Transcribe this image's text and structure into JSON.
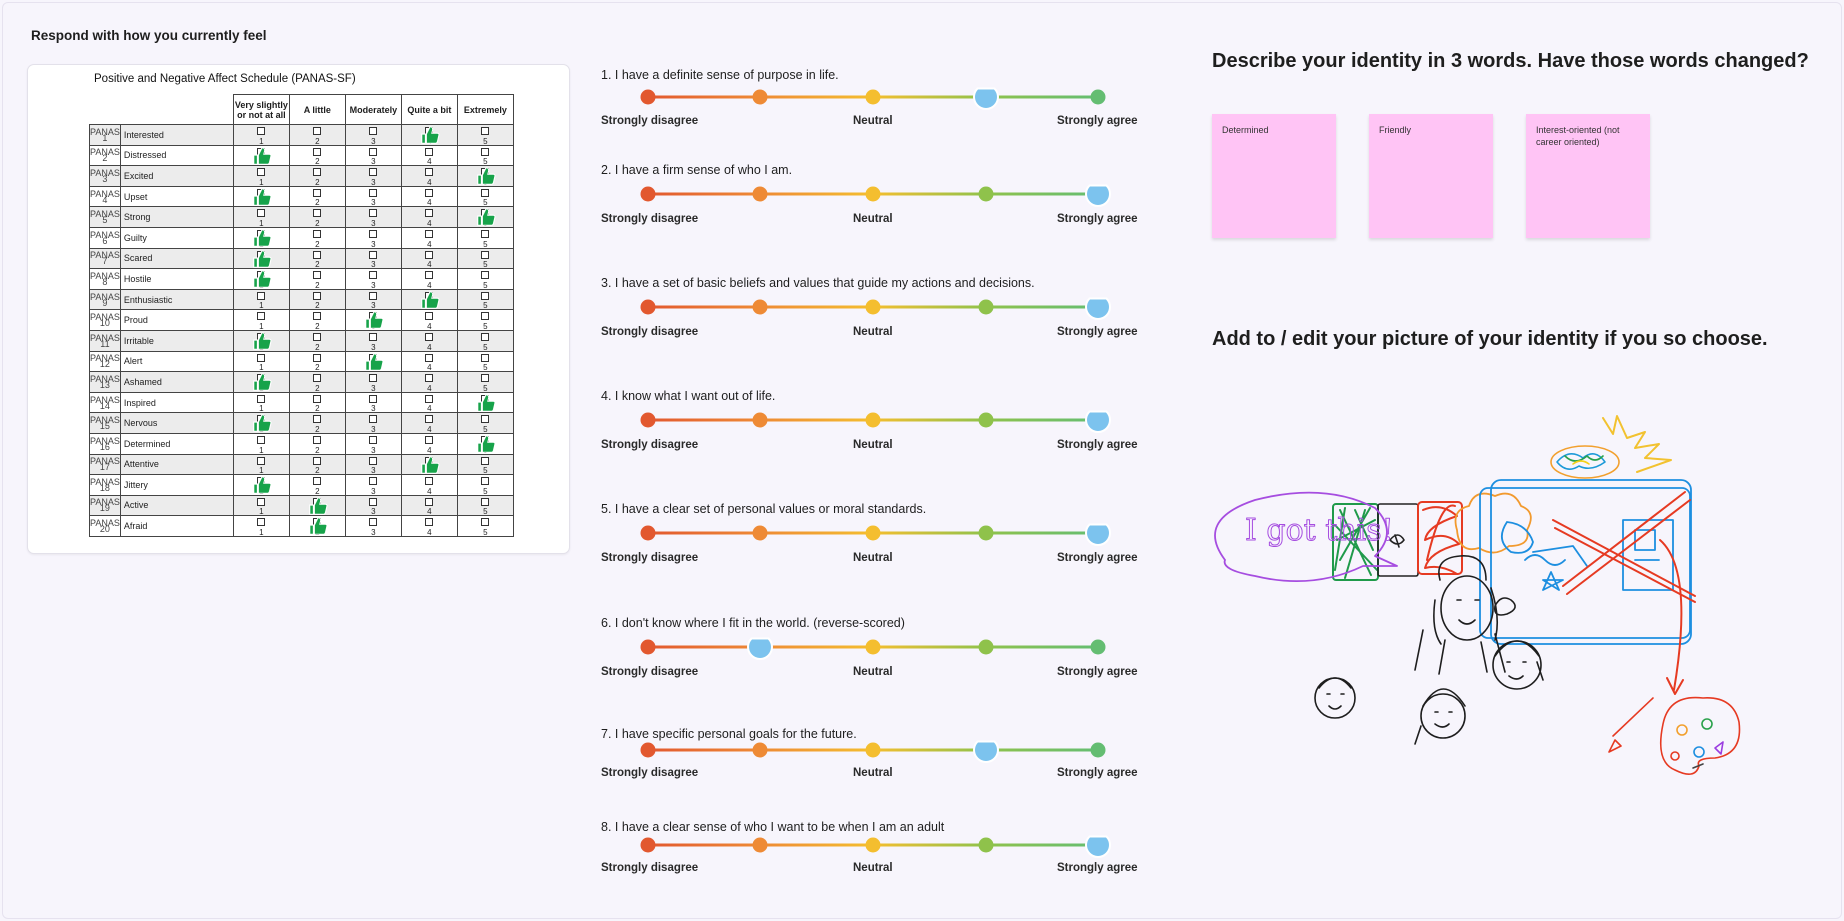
{
  "section_title": "Respond with how you currently feel",
  "panas": {
    "title": "Positive and Negative Affect Schedule (PANAS-SF)",
    "headers": [
      "Very slightly or not at all",
      "A little",
      "Moderately",
      "Quite a bit",
      "Extremely"
    ],
    "code_prefix": "PANAS",
    "items": [
      {
        "code": "1",
        "label": "Interested",
        "selected": 4
      },
      {
        "code": "2",
        "label": "Distressed",
        "selected": 1
      },
      {
        "code": "3",
        "label": "Excited",
        "selected": 5
      },
      {
        "code": "4",
        "label": "Upset",
        "selected": 1
      },
      {
        "code": "5",
        "label": "Strong",
        "selected": 5
      },
      {
        "code": "6",
        "label": "Guilty",
        "selected": 1
      },
      {
        "code": "7",
        "label": "Scared",
        "selected": 1
      },
      {
        "code": "8",
        "label": "Hostile",
        "selected": 1
      },
      {
        "code": "9",
        "label": "Enthusiastic",
        "selected": 4
      },
      {
        "code": "10",
        "label": "Proud",
        "selected": 3
      },
      {
        "code": "11",
        "label": "Irritable",
        "selected": 1
      },
      {
        "code": "12",
        "label": "Alert",
        "selected": 3
      },
      {
        "code": "13",
        "label": "Ashamed",
        "selected": 1
      },
      {
        "code": "14",
        "label": "Inspired",
        "selected": 5
      },
      {
        "code": "15",
        "label": "Nervous",
        "selected": 1
      },
      {
        "code": "16",
        "label": "Determined",
        "selected": 5
      },
      {
        "code": "17",
        "label": "Attentive",
        "selected": 4
      },
      {
        "code": "18",
        "label": "Jittery",
        "selected": 1
      },
      {
        "code": "19",
        "label": "Active",
        "selected": 2
      },
      {
        "code": "20",
        "label": "Afraid",
        "selected": 2
      }
    ]
  },
  "questions": [
    {
      "text": "1. I have a definite sense of purpose in life.",
      "value": 4
    },
    {
      "text": "2. I have a firm sense of who I am.",
      "value": 5
    },
    {
      "text": "3. I have a set of basic beliefs and values that guide my actions and decisions.",
      "value": 5
    },
    {
      "text": "4. I know what I want out of life.",
      "value": 5
    },
    {
      "text": "5. I have a clear set of personal values or moral standards.",
      "value": 5
    },
    {
      "text": "6. I don't know where I fit in the world. (reverse-scored)",
      "value": 2
    },
    {
      "text": "7. I have specific personal goals for the future.",
      "value": 4
    },
    {
      "text": "8. I have a clear sense of who I want to be when I am an adult",
      "value": 5
    }
  ],
  "scale_labels": {
    "left": "Strongly disagree",
    "middle": "Neutral",
    "right": "Strongly agree"
  },
  "scale_colors": [
    "#e2582f",
    "#ee8a35",
    "#f4be2f",
    "#8fc24b",
    "#64bd72"
  ],
  "handle_color": "#7cc3ee",
  "identity": {
    "heading": "Describe your identity in 3 words. Have those words changed?",
    "words": [
      "Determined",
      "Friendly",
      "Interest-oriented (not career oriented)"
    ]
  },
  "drawing": {
    "heading": "Add to / edit your picture of your identity if you so choose.",
    "speech_text": "I got this!"
  }
}
